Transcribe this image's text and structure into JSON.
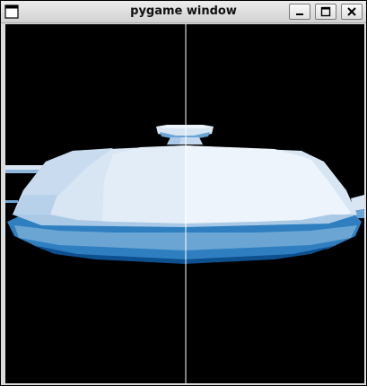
{
  "window": {
    "title": "pygame window",
    "controls": [
      {
        "name": "minimize",
        "icon": "minimize-icon"
      },
      {
        "name": "maximize",
        "icon": "maximize-icon"
      },
      {
        "name": "close",
        "icon": "close-icon"
      }
    ]
  },
  "viewport": {
    "background": "#000000",
    "scene": "teapot-render",
    "palette": {
      "highlight": "#eef4fb",
      "light": "#d8e6f4",
      "mid": "#a9c9e6",
      "midDark": "#6aa5d4",
      "dark": "#2f7fc0",
      "deep": "#0d4f8f",
      "guide": "#ffffff"
    }
  }
}
